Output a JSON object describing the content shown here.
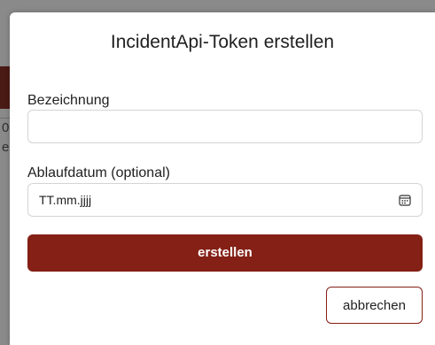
{
  "background": {
    "partial_chars": [
      "0",
      "e"
    ]
  },
  "dialog": {
    "title": "IncidentApi-Token erstellen",
    "name_field": {
      "label": "Bezeichnung",
      "value": ""
    },
    "expiry_field": {
      "label": "Ablaufdatum (optional)",
      "value": "TT.mm.jjjj",
      "icon": "calendar-icon"
    },
    "create_button_label": "erstellen",
    "cancel_button_label": "abbrechen"
  },
  "colors": {
    "accent": "#842015",
    "backdrop": "#8a8a8a",
    "input_border": "#d4d4d4"
  }
}
